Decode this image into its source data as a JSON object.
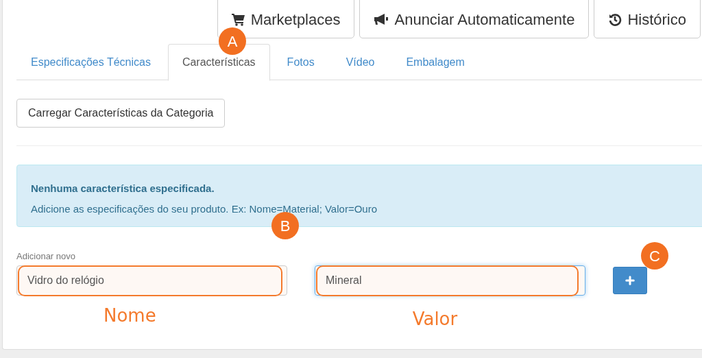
{
  "top_buttons": [
    {
      "label": "Marketplaces"
    },
    {
      "label": "Anunciar Automaticamente"
    },
    {
      "label": "Histórico"
    }
  ],
  "tabs": [
    {
      "label": "Especificações Técnicas",
      "selected": false
    },
    {
      "label": "Características",
      "selected": true
    },
    {
      "label": "Fotos",
      "selected": false
    },
    {
      "label": "Vídeo",
      "selected": false
    },
    {
      "label": "Embalagem",
      "selected": false
    }
  ],
  "load_button": "Carregar Características da Categoria",
  "alert": {
    "title": "Nenhuma característica especificada.",
    "message": "Adicione as especificações do seu produto. Ex: Nome=Material; Valor=Ouro"
  },
  "new_field": {
    "label": "Adicionar novo",
    "name_input": {
      "value": "Vidro do relógio",
      "focused": false
    },
    "value_input": {
      "value": "Mineral",
      "focused": true
    }
  },
  "annotation_labels": [
    "Nome",
    "Valor"
  ],
  "callouts": [
    "A",
    "B",
    "C"
  ]
}
